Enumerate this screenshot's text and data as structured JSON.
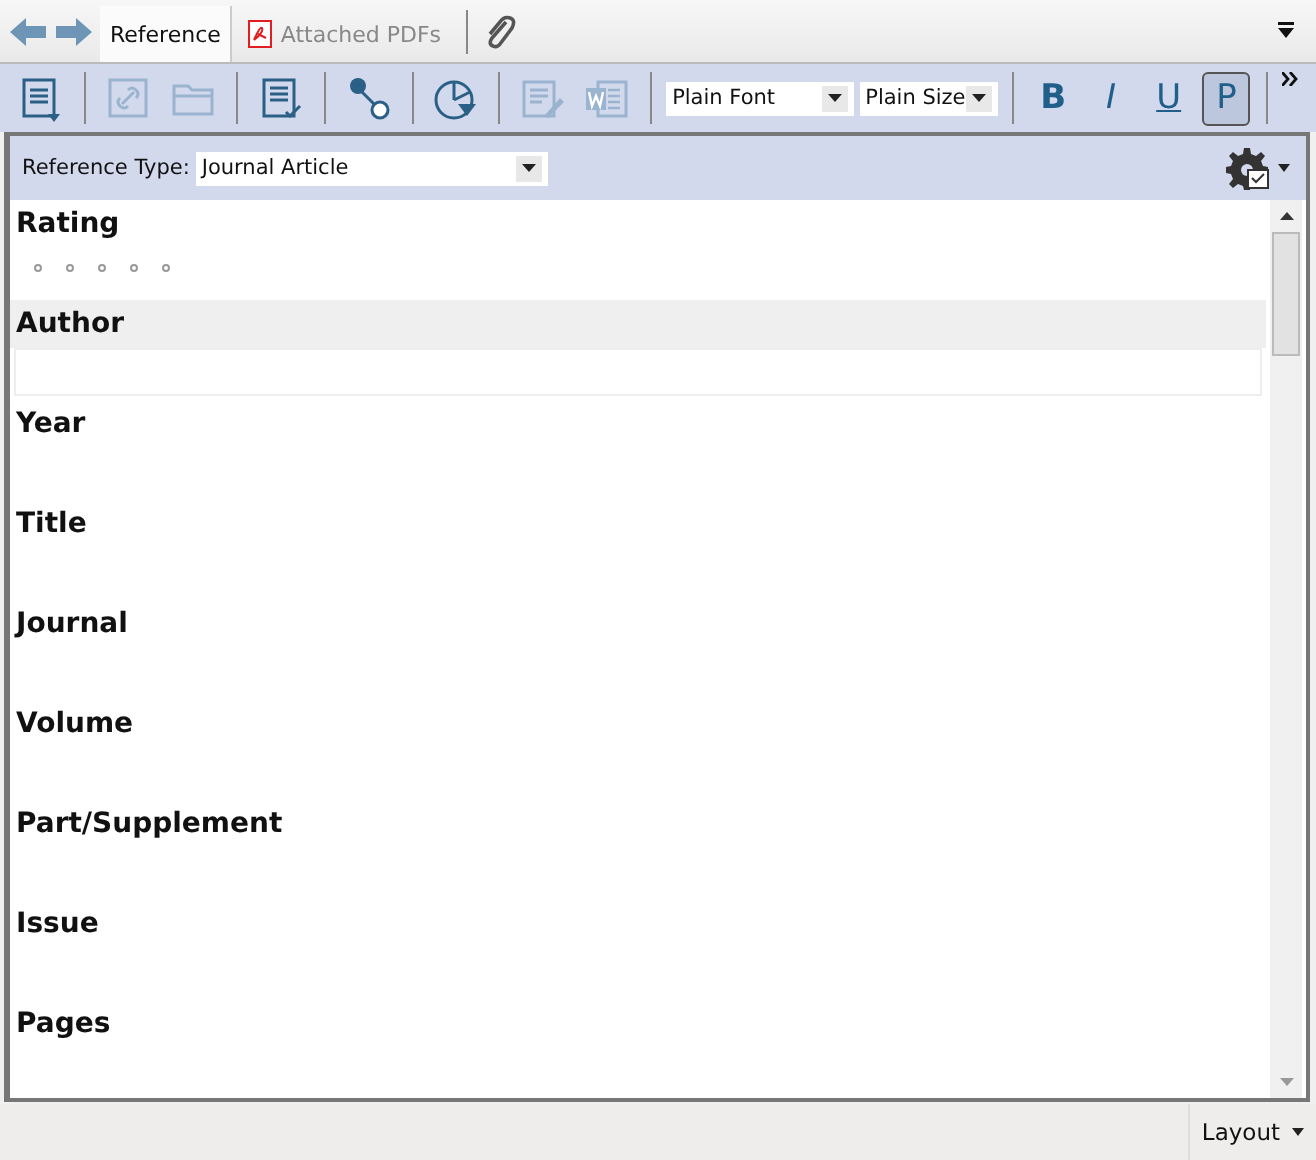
{
  "tabs": [
    {
      "label": "Reference",
      "kind": "plain",
      "selected": true
    },
    {
      "label": "Attached PDFs",
      "kind": "pdf",
      "selected": false
    }
  ],
  "toolbar": {
    "tools": [
      {
        "kind": "insert",
        "disabled": false
      },
      {
        "kind": "link",
        "disabled": true
      },
      {
        "kind": "folder",
        "disabled": true
      },
      {
        "kind": "checklist",
        "disabled": false
      },
      {
        "kind": "connect",
        "disabled": false
      },
      {
        "kind": "pie",
        "disabled": false
      },
      {
        "kind": "edit",
        "disabled": true
      },
      {
        "kind": "word",
        "disabled": true
      }
    ],
    "font": "Plain Font",
    "size": "Plain Size",
    "styles": [
      {
        "label": "B",
        "kind": "bold",
        "on": false
      },
      {
        "label": "I",
        "kind": "italic",
        "on": false
      },
      {
        "label": "U",
        "kind": "underline",
        "on": false
      },
      {
        "label": "P",
        "kind": "plain",
        "on": true
      }
    ]
  },
  "reference_type": {
    "label": "Reference Type:",
    "value": "Journal Article"
  },
  "fields": [
    {
      "label": "Rating",
      "kind": "rating",
      "stars": 0,
      "selected": false
    },
    {
      "label": "Author",
      "kind": "text",
      "selected": true
    },
    {
      "label": "Year",
      "kind": "text",
      "selected": false
    },
    {
      "label": "Title",
      "kind": "text",
      "selected": false
    },
    {
      "label": "Journal",
      "kind": "text",
      "selected": false
    },
    {
      "label": "Volume",
      "kind": "text",
      "selected": false
    },
    {
      "label": "Part/Supplement",
      "kind": "text",
      "selected": false
    },
    {
      "label": "Issue",
      "kind": "text",
      "selected": false
    },
    {
      "label": "Pages",
      "kind": "text",
      "selected": false
    }
  ],
  "status_bar": {
    "layout": "Layout"
  }
}
